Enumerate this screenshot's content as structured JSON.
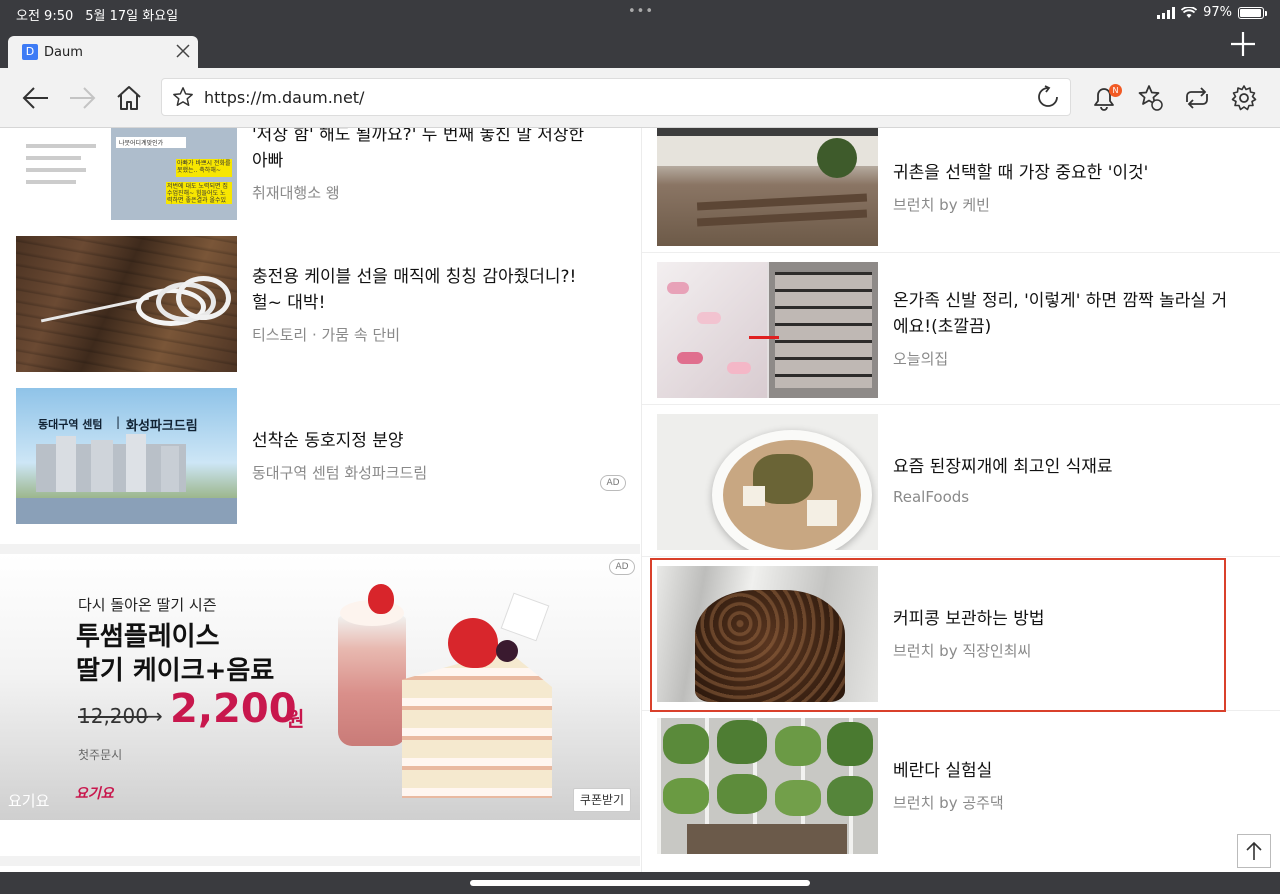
{
  "status": {
    "time": "오전 9:50",
    "date": "5월 17일 화요일",
    "battery": "97%",
    "battery_level": 0.97
  },
  "tab": {
    "favicon": "D",
    "title": "Daum"
  },
  "toolbar": {
    "url": "https://m.daum.net/",
    "notification_badge": "N"
  },
  "left_items": [
    {
      "title": "'저장 함' 해도 될까요?' 두 번째 놓친 말 저장한",
      "title2": "아빠",
      "source": "취재대행소 왱",
      "thumb": "chat-screenshot"
    },
    {
      "title": "충전용 케이블 선을 매직에 칭칭 감아줬더니?!",
      "title2": "헐~ 대박!",
      "source": "티스토리 · 가뭄 속 단비",
      "thumb": "cable-on-wood"
    },
    {
      "title": "선착순 동호지정 분양",
      "title2": "",
      "source": "동대구역 센텀 화성파크드림",
      "thumb": "apartment-render",
      "ad": "AD"
    }
  ],
  "thumb_text": {
    "chat_header": "나뭇어디계맞인가",
    "chat_bubble1": "아빠가 바쁘시 전화를 못했는.. 축하해~",
    "chat_bubble2": "저번에 대도 노력되면 집수업진해~ 힘들어도 노력하면 좋은결과 올수있어~",
    "apt_label1": "동대구역 센텀",
    "apt_label2": "화성파크드림"
  },
  "banner": {
    "ad": "AD",
    "subtitle": "다시 돌아온 딸기 시즌",
    "headline1": "투썸플레이스",
    "headline2": "딸기 케이크+음료",
    "old_price": "12,200",
    "arrow": "→",
    "new_price": "2,200",
    "won": "원",
    "note": "첫주문시",
    "brand_left": "요기요",
    "brand_logo": "요기요",
    "coupon": "쿠폰받기"
  },
  "right_items": [
    {
      "title": "귀촌을 선택할 때 가장 중요한 '이것'",
      "title2": "",
      "source": "브런치 by 케빈",
      "thumb": "field-house"
    },
    {
      "title": "온가족 신발 정리, '이렇게' 하면 깜짝 놀라실 거",
      "title2": "에요!(초깔끔)",
      "source": "오늘의집",
      "thumb": "shoe-rack"
    },
    {
      "title": "요즘 된장찌개에 최고인 식재료",
      "title2": "",
      "source": "RealFoods",
      "thumb": "soybean-stew"
    },
    {
      "title": "커피콩 보관하는 방법",
      "title2": "",
      "source": "브런치 by 직장인최씨",
      "thumb": "coffee-beans-bag"
    },
    {
      "title": "베란다 실험실",
      "title2": "",
      "source": "브런치 by 공주댁",
      "thumb": "veranda-plants"
    }
  ],
  "colors": {
    "chrome": "#3a3b3f",
    "highlight": "#d9402b",
    "price": "#c8174d",
    "brand": "#fa0050"
  }
}
